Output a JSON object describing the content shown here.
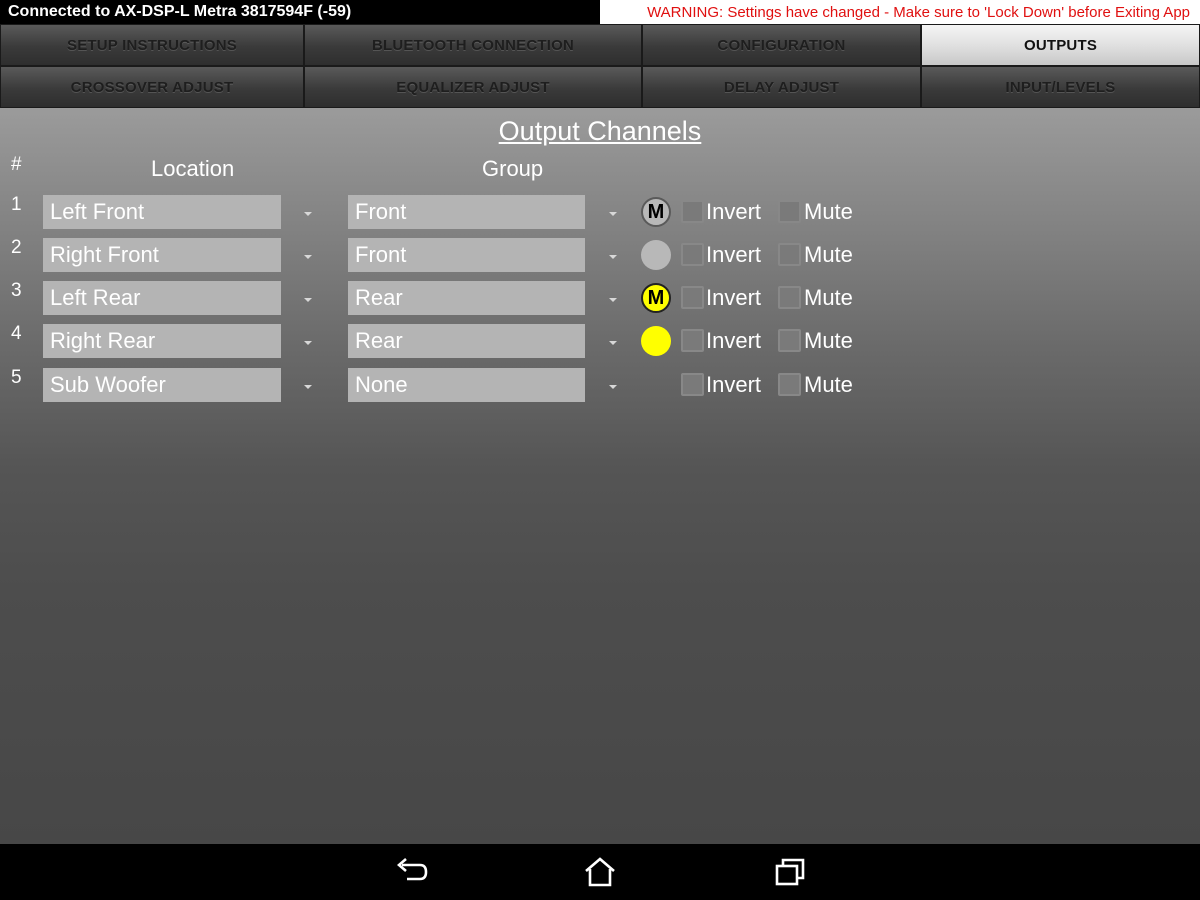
{
  "status": {
    "connection": "Connected to AX-DSP-L Metra 3817594F (-59)",
    "warning": "WARNING: Settings have changed - Make sure to 'Lock Down' before Exiting App",
    "warning_color": "#e01010"
  },
  "tabs_row1": [
    "SETUP INSTRUCTIONS",
    "BLUETOOTH CONNECTION",
    "CONFIGURATION",
    "OUTPUTS"
  ],
  "tabs_row2": [
    "CROSSOVER ADJUST",
    "EQUALIZER ADJUST",
    "DELAY ADJUST",
    "INPUT/LEVELS"
  ],
  "active_tab": "OUTPUTS",
  "page": {
    "title": "Output Channels",
    "col_num": "#",
    "col_location": "Location",
    "col_group": "Group",
    "invert_label": "Invert",
    "mute_label": "Mute"
  },
  "channels": [
    {
      "num": "1",
      "location": "Left Front",
      "group": "Front",
      "indicator": "gray",
      "indicator_label": "M",
      "invert": false,
      "mute": false
    },
    {
      "num": "2",
      "location": "Right Front",
      "group": "Front",
      "indicator": "gray",
      "indicator_label": "",
      "invert": false,
      "mute": false
    },
    {
      "num": "3",
      "location": "Left Rear",
      "group": "Rear",
      "indicator": "yellow",
      "indicator_label": "M",
      "invert": false,
      "mute": false
    },
    {
      "num": "4",
      "location": "Right Rear",
      "group": "Rear",
      "indicator": "yellow",
      "indicator_label": "",
      "invert": false,
      "mute": false
    },
    {
      "num": "5",
      "location": "Sub Woofer",
      "group": "None",
      "indicator": "none",
      "indicator_label": "",
      "invert": false,
      "mute": false
    }
  ],
  "nav": {
    "back_icon": "back-arrow-icon",
    "home_icon": "home-icon",
    "recents_icon": "recent-apps-icon"
  }
}
